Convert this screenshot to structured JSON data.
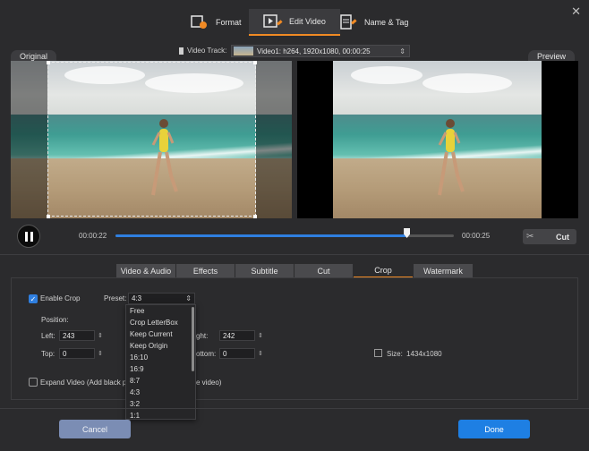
{
  "tabs": [
    {
      "label": "Format",
      "icon": "format-icon"
    },
    {
      "label": "Edit Video",
      "icon": "edit-video-icon",
      "active": true
    },
    {
      "label": "Name & Tag",
      "icon": "name-tag-icon"
    }
  ],
  "panes": {
    "original_label": "Original",
    "preview_label": "Preview"
  },
  "video_track": {
    "label": "Video Track:",
    "value": "Video1: h264, 1920x1080, 00:00:25"
  },
  "playback": {
    "current_time": "00:00:22",
    "end_time": "00:00:25",
    "progress": 0.86,
    "cut_label": "Cut"
  },
  "subtabs": [
    {
      "label": "Video & Audio"
    },
    {
      "label": "Effects"
    },
    {
      "label": "Subtitle"
    },
    {
      "label": "Cut"
    },
    {
      "label": "Crop",
      "active": true
    },
    {
      "label": "Watermark"
    }
  ],
  "crop": {
    "enable_label": "Enable Crop",
    "enabled": true,
    "preset_label": "Preset:",
    "preset_value": "4:3",
    "position_label": "Position:",
    "left_label": "Left:",
    "left_value": "243",
    "top_label": "Top:",
    "top_value": "0",
    "right_label_partial": "ght:",
    "right_value": "242",
    "bottom_label_partial": "ottom:",
    "bottom_value": "0",
    "size_label": "Size:",
    "size_value": "1434x1080",
    "expand_label_left": "Expand Video (Add black pac",
    "expand_label_right": "e video)",
    "expand_checked": false,
    "preset_options": [
      "Free",
      "Crop LetterBox",
      "Keep Current",
      "Keep Origin",
      "16:10",
      "16:9",
      "8:7",
      "4:3",
      "3:2",
      "1:1"
    ]
  },
  "buttons": {
    "cancel": "Cancel",
    "done": "Done"
  },
  "colors": {
    "accent": "#f08a24",
    "primary": "#1e7fe3",
    "progress": "#2f7fe0",
    "cancel": "#7b8db4"
  }
}
